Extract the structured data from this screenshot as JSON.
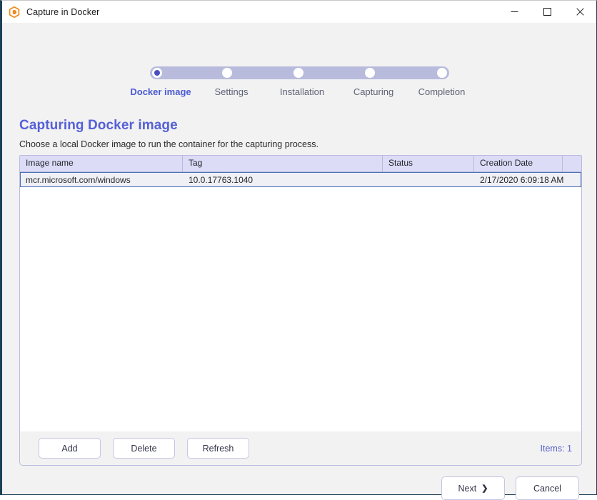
{
  "window": {
    "title": "Capture in Docker",
    "app_icon": "app-logo-icon",
    "controls": {
      "minimize": "minimize-icon",
      "maximize": "maximize-icon",
      "close": "close-icon"
    }
  },
  "stepper": {
    "active_index": 0,
    "steps": [
      {
        "label": "Docker image"
      },
      {
        "label": "Settings"
      },
      {
        "label": "Installation"
      },
      {
        "label": "Capturing"
      },
      {
        "label": "Completion"
      }
    ]
  },
  "page": {
    "title": "Capturing Docker image",
    "subtitle": "Choose a local Docker image to run the container for the capturing process."
  },
  "grid": {
    "columns": [
      {
        "key": "name",
        "label": "Image name"
      },
      {
        "key": "tag",
        "label": "Tag"
      },
      {
        "key": "status",
        "label": "Status"
      },
      {
        "key": "date",
        "label": "Creation Date"
      }
    ],
    "rows": [
      {
        "name": "mcr.microsoft.com/windows",
        "tag": "10.0.17763.1040",
        "status": "",
        "date": "2/17/2020 6:09:18 AM",
        "selected": true
      }
    ]
  },
  "grid_footer": {
    "add_label": "Add",
    "delete_label": "Delete",
    "refresh_label": "Refresh",
    "items_count": "Items: 1"
  },
  "wizard_nav": {
    "next_label": "Next",
    "next_icon": "chevron-right-icon",
    "cancel_label": "Cancel"
  },
  "colors": {
    "accent": "#5560d6",
    "track": "#b9bbdd",
    "header_bg": "#dcdcf7",
    "selection_bg": "#eff0f5",
    "selection_border": "#4b6fb5",
    "window_border": "#1d4158",
    "logo_orange": "#ef8a1b"
  }
}
